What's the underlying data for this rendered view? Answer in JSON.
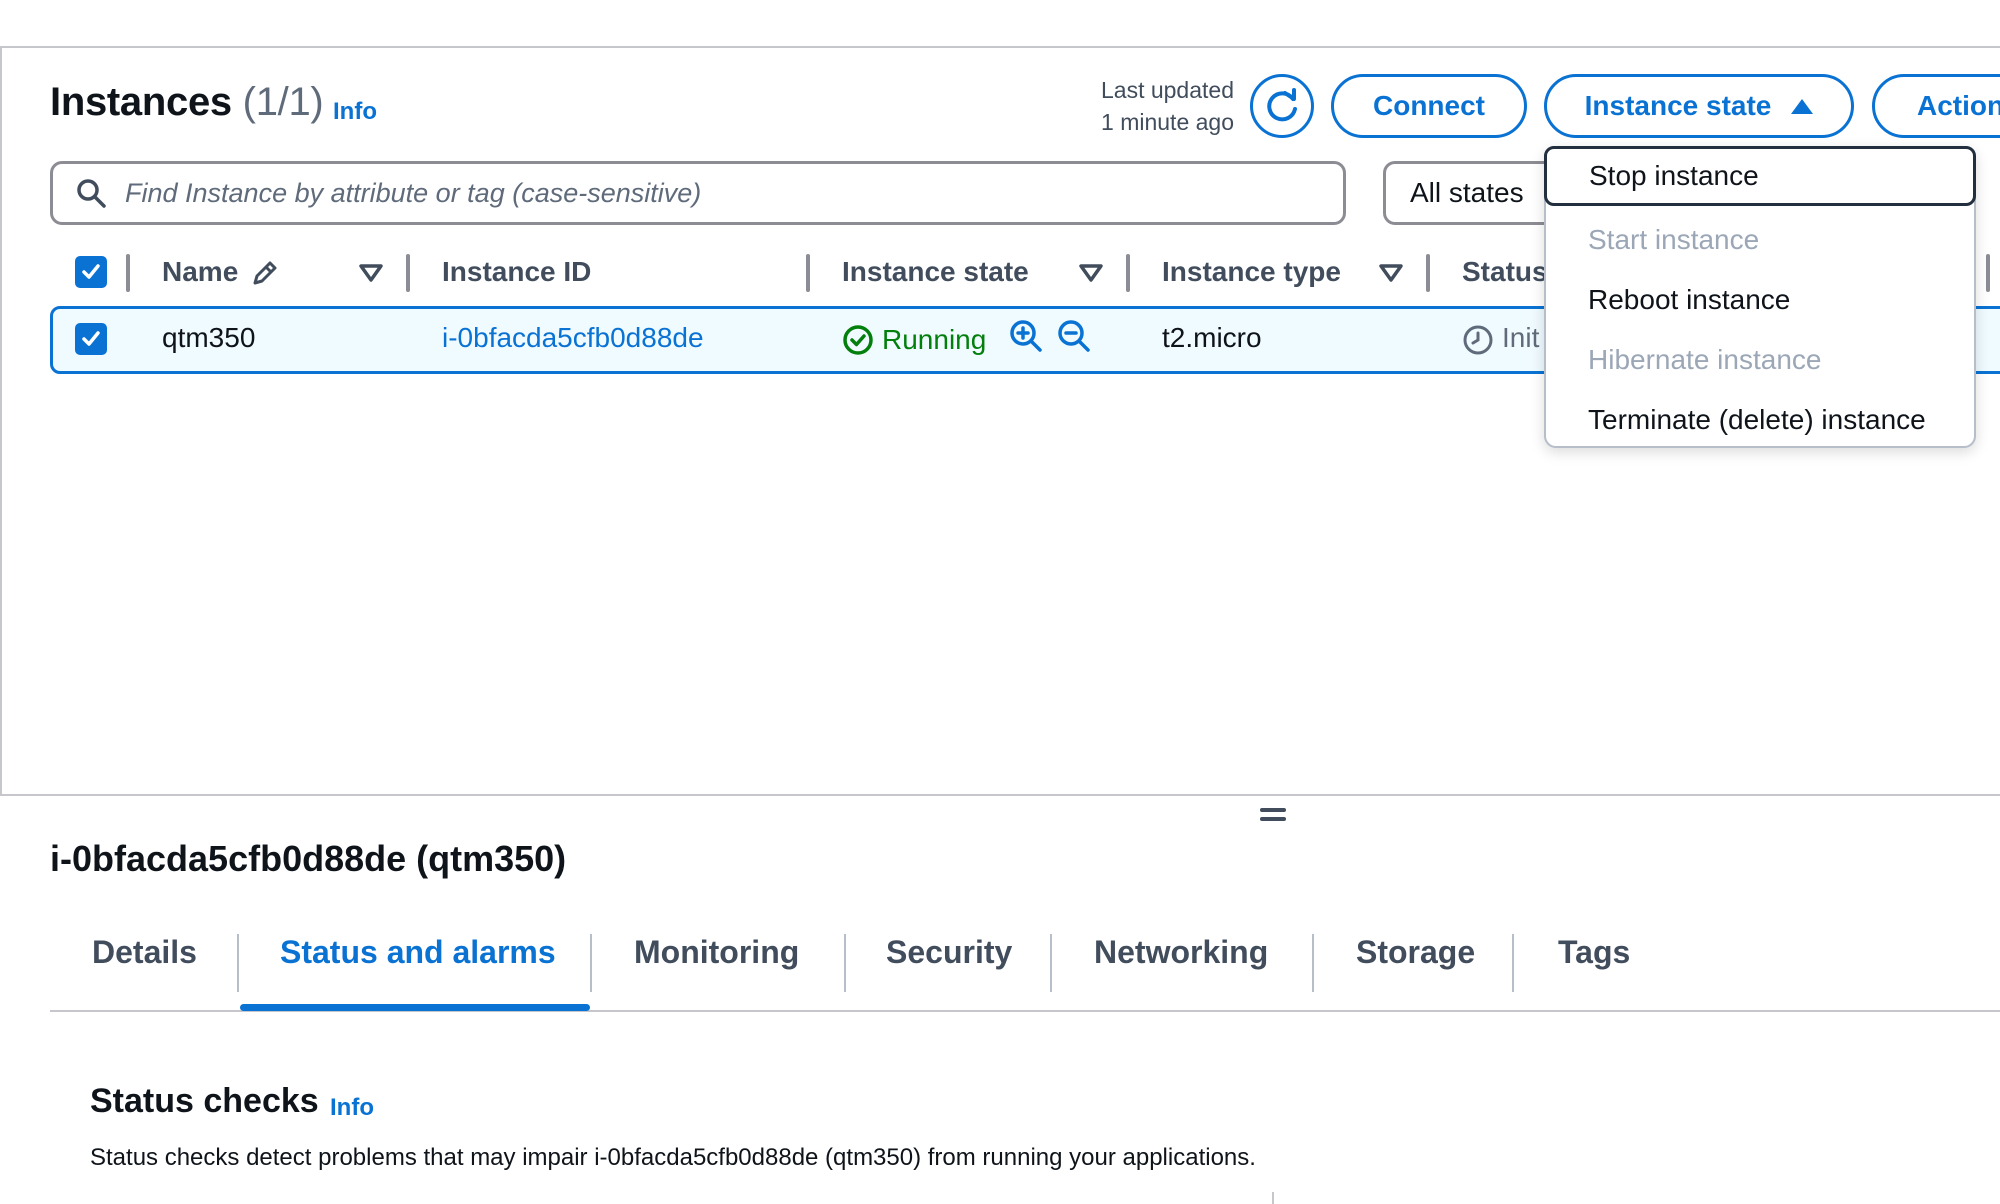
{
  "header": {
    "title": "Instances",
    "count": "(1/1)",
    "info": "Info",
    "last_updated_line1": "Last updated",
    "last_updated_line2": "1 minute ago",
    "connect_label": "Connect",
    "instance_state_label": "Instance state",
    "actions_label": "Action"
  },
  "search": {
    "placeholder": "Find Instance by attribute or tag (case-sensitive)"
  },
  "states_filter": {
    "value": "All states"
  },
  "table": {
    "columns": [
      "Name",
      "Instance ID",
      "Instance state",
      "Instance type",
      "Status"
    ],
    "rows": [
      {
        "name": "qtm350",
        "instance_id": "i-0bfacda5cfb0d88de",
        "state": "Running",
        "type": "t2.micro",
        "status": "Init"
      }
    ]
  },
  "dropdown": {
    "items": [
      {
        "label": "Stop instance",
        "disabled": false
      },
      {
        "label": "Start instance",
        "disabled": true
      },
      {
        "label": "Reboot instance",
        "disabled": false
      },
      {
        "label": "Hibernate instance",
        "disabled": true
      },
      {
        "label": "Terminate (delete) instance",
        "disabled": false
      }
    ]
  },
  "details": {
    "title": "i-0bfacda5cfb0d88de (qtm350)",
    "tabs": [
      "Details",
      "Status and alarms",
      "Monitoring",
      "Security",
      "Networking",
      "Storage",
      "Tags"
    ],
    "active_tab": "Status and alarms",
    "status_checks_title": "Status checks",
    "status_checks_info": "Info",
    "status_checks_desc": "Status checks detect problems that may impair i-0bfacda5cfb0d88de (qtm350) from running your applications."
  },
  "colors": {
    "accent": "#0972d3",
    "success": "#037f0c",
    "disabled": "#9ba7b6"
  }
}
